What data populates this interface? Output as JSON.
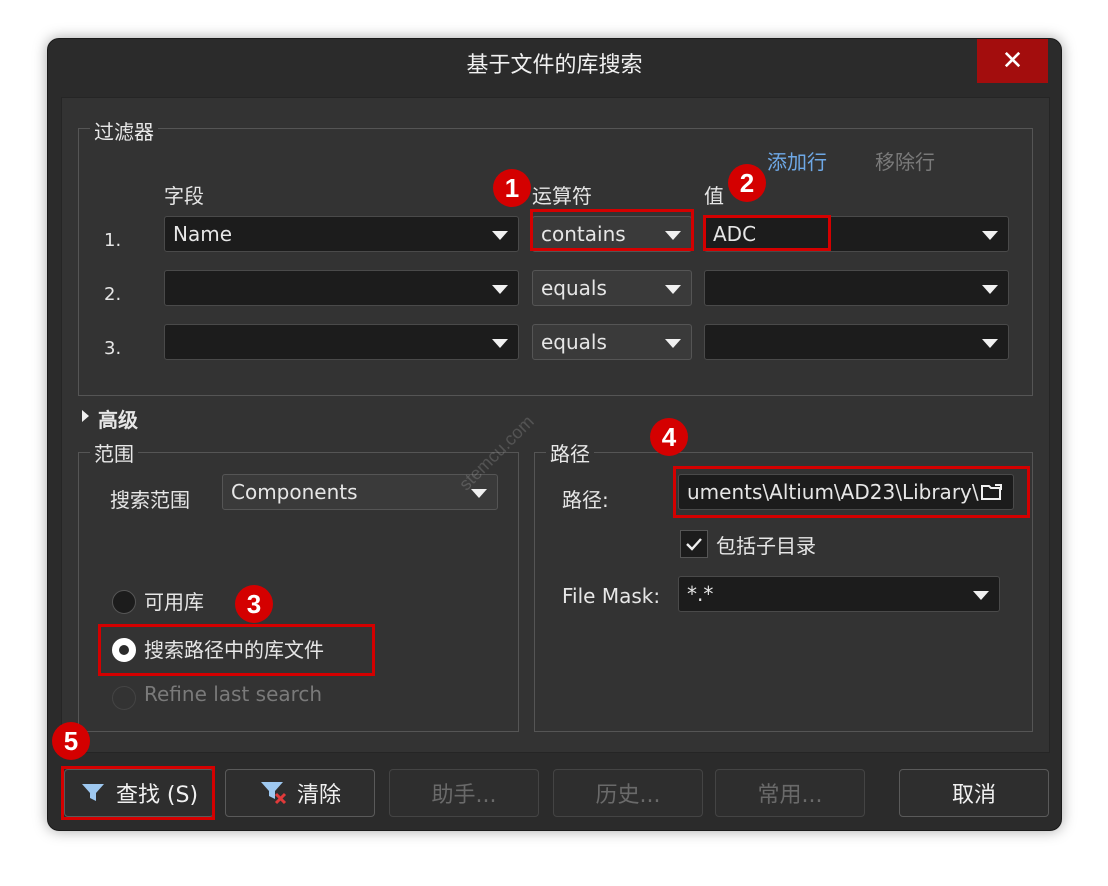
{
  "window": {
    "title": "基于文件的库搜索",
    "close_label": "✕"
  },
  "filters": {
    "group_title": "过滤器",
    "add_row": "添加行",
    "remove_row": "移除行",
    "headers": {
      "field": "字段",
      "operator": "运算符",
      "value": "值"
    },
    "rows": [
      {
        "index": "1.",
        "field": "Name",
        "operator": "contains",
        "value": "ADC"
      },
      {
        "index": "2.",
        "field": "",
        "operator": "equals",
        "value": ""
      },
      {
        "index": "3.",
        "field": "",
        "operator": "equals",
        "value": ""
      }
    ]
  },
  "advanced_label": "高级",
  "scope": {
    "group_title": "范围",
    "search_scope_label": "搜索范围",
    "search_scope_value": "Components",
    "options": [
      "可用库",
      "搜索路径中的库文件",
      "Refine last search"
    ],
    "selected": "搜索路径中的库文件"
  },
  "path": {
    "group_title": "路径",
    "path_label": "路径:",
    "path_value": "uments\\Altium\\AD23\\Library\\",
    "include_subdirs_label": "包括子目录",
    "include_subdirs_checked": true,
    "file_mask_label": "File Mask:",
    "file_mask_value": "*.*"
  },
  "buttons": {
    "search": "查找 (S)",
    "clear": "清除",
    "helper": "助手...",
    "history": "历史...",
    "favorites": "常用...",
    "cancel": "取消"
  },
  "annotations": [
    "1",
    "2",
    "3",
    "4",
    "5"
  ],
  "watermark": "stemcu.com",
  "colors": {
    "accent_link": "#6ea8e6",
    "highlight": "#d40000",
    "close": "#a30d0d"
  }
}
